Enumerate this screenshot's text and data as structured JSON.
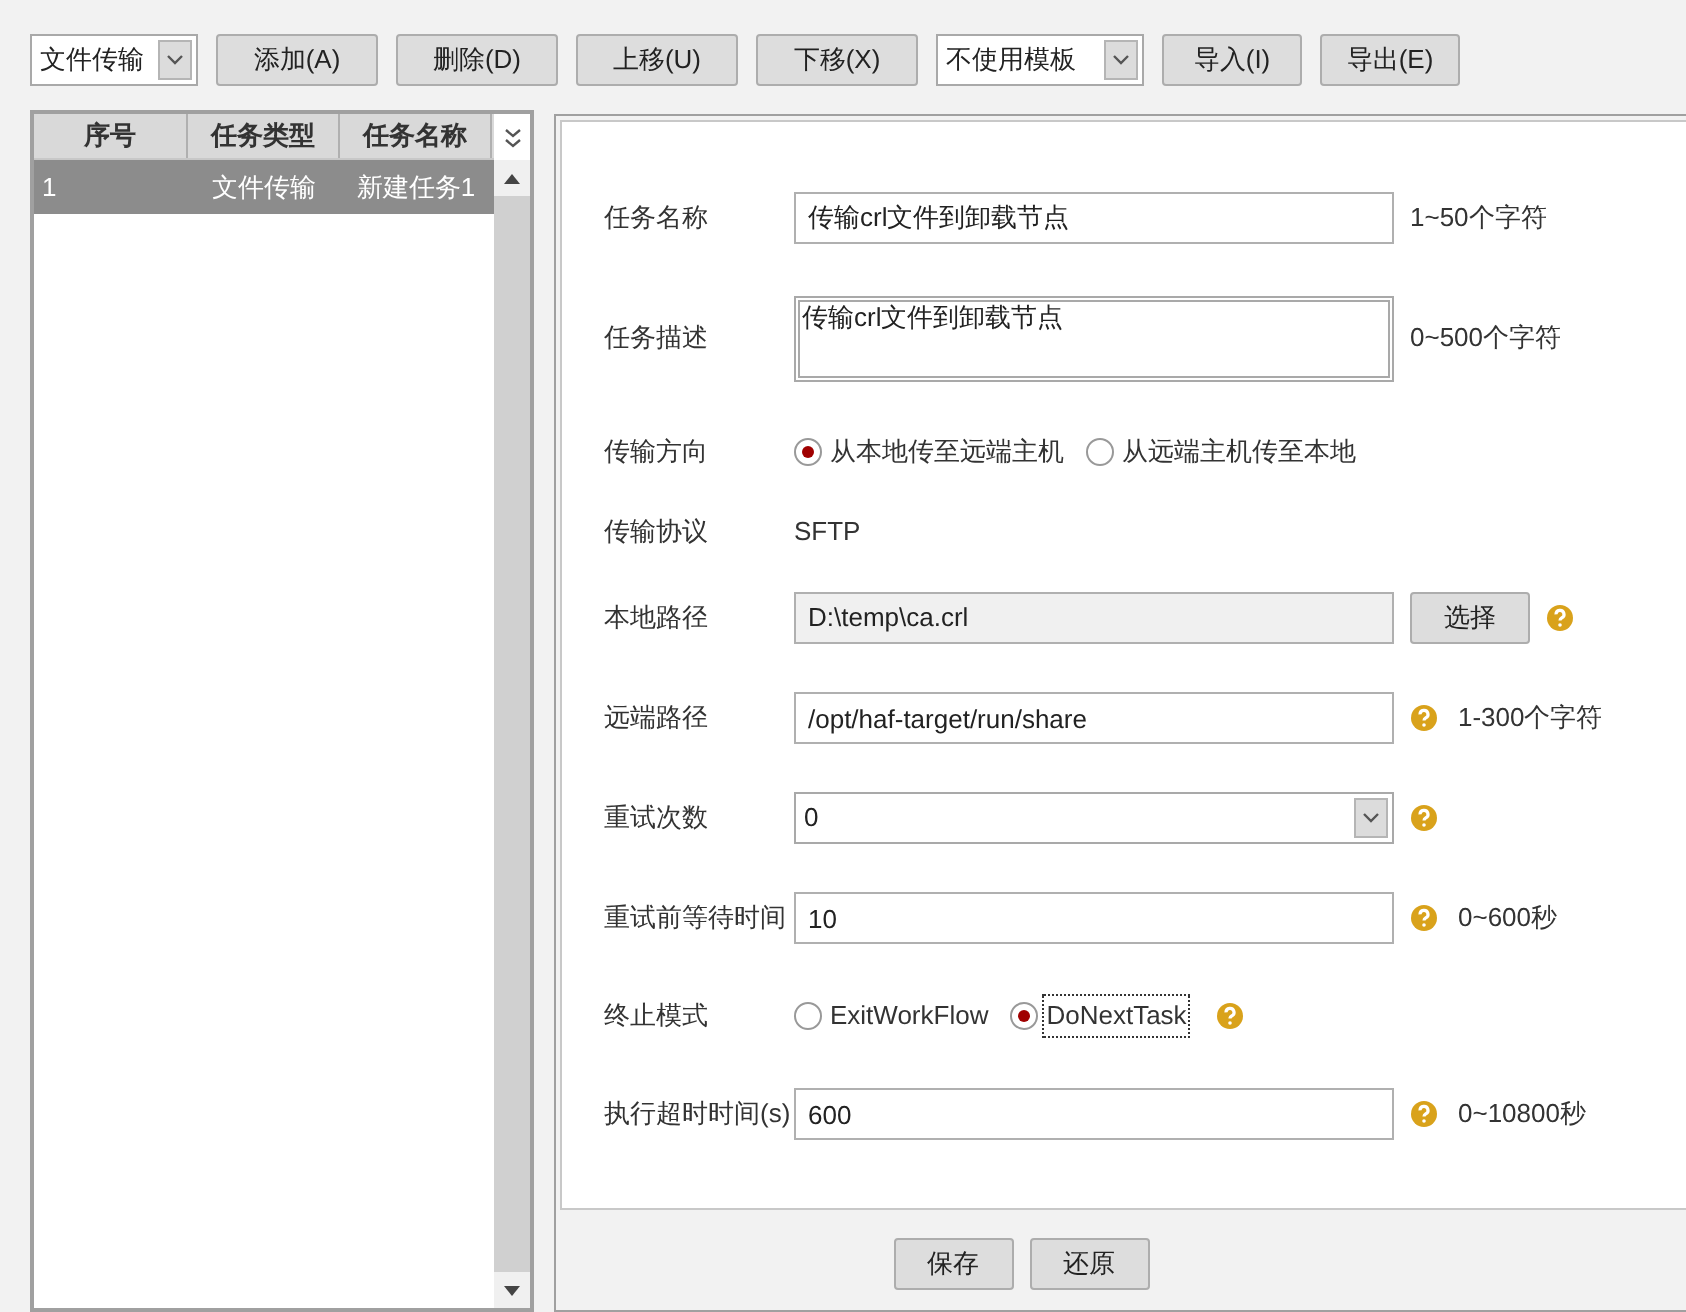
{
  "toolbar": {
    "type_select": {
      "value": "文件传输"
    },
    "buttons_left": [
      {
        "label": "添加(A)"
      },
      {
        "label": "删除(D)"
      },
      {
        "label": "上移(U)"
      },
      {
        "label": "下移(X)"
      }
    ],
    "template_select": {
      "value": "不使用模板"
    },
    "buttons_right": [
      {
        "label": "导入(I)"
      },
      {
        "label": "导出(E)"
      }
    ]
  },
  "task_table": {
    "columns": [
      "序号",
      "任务类型",
      "任务名称"
    ],
    "rows": [
      {
        "cells": [
          "1",
          "文件传输",
          "新建任务1"
        ],
        "selected": true
      }
    ]
  },
  "form": {
    "rows": [
      {
        "kind": "text",
        "label": "任务名称",
        "value": "传输crl文件到卸载节点",
        "help": false,
        "hint": "1~50个字符"
      },
      {
        "kind": "textarea",
        "label": "任务描述",
        "value": "传输crl文件到卸载节点",
        "help": false,
        "hint": "0~500个字符"
      },
      {
        "kind": "radio",
        "label": "传输方向",
        "options": [
          {
            "label": "从本地传至远端主机",
            "selected": true,
            "focused": false
          },
          {
            "label": "从远端主机传至本地",
            "selected": false,
            "focused": false
          }
        ],
        "help": false
      },
      {
        "kind": "static",
        "label": "传输协议",
        "value": "SFTP"
      },
      {
        "kind": "path",
        "label": "本地路径",
        "value": "D:\\temp\\ca.crl",
        "button": "选择",
        "help": true
      },
      {
        "kind": "text",
        "label": "远端路径",
        "value": "/opt/haf-target/run/share",
        "help": true,
        "hint": "1-300个字符"
      },
      {
        "kind": "select",
        "label": "重试次数",
        "value": "0",
        "help": true
      },
      {
        "kind": "text",
        "label": "重试前等待时间",
        "value": "10",
        "help": true,
        "hint": "0~600秒"
      },
      {
        "kind": "radio",
        "label": "终止模式",
        "options": [
          {
            "label": "ExitWorkFlow",
            "selected": false,
            "focused": false
          },
          {
            "label": "DoNextTask",
            "selected": true,
            "focused": true
          }
        ],
        "help": true
      },
      {
        "kind": "text",
        "label": "执行超时时间(s)",
        "value": "600",
        "help": true,
        "hint": "0~10800秒"
      }
    ]
  },
  "footer_buttons": [
    {
      "label": "保存"
    },
    {
      "label": "还原"
    }
  ]
}
